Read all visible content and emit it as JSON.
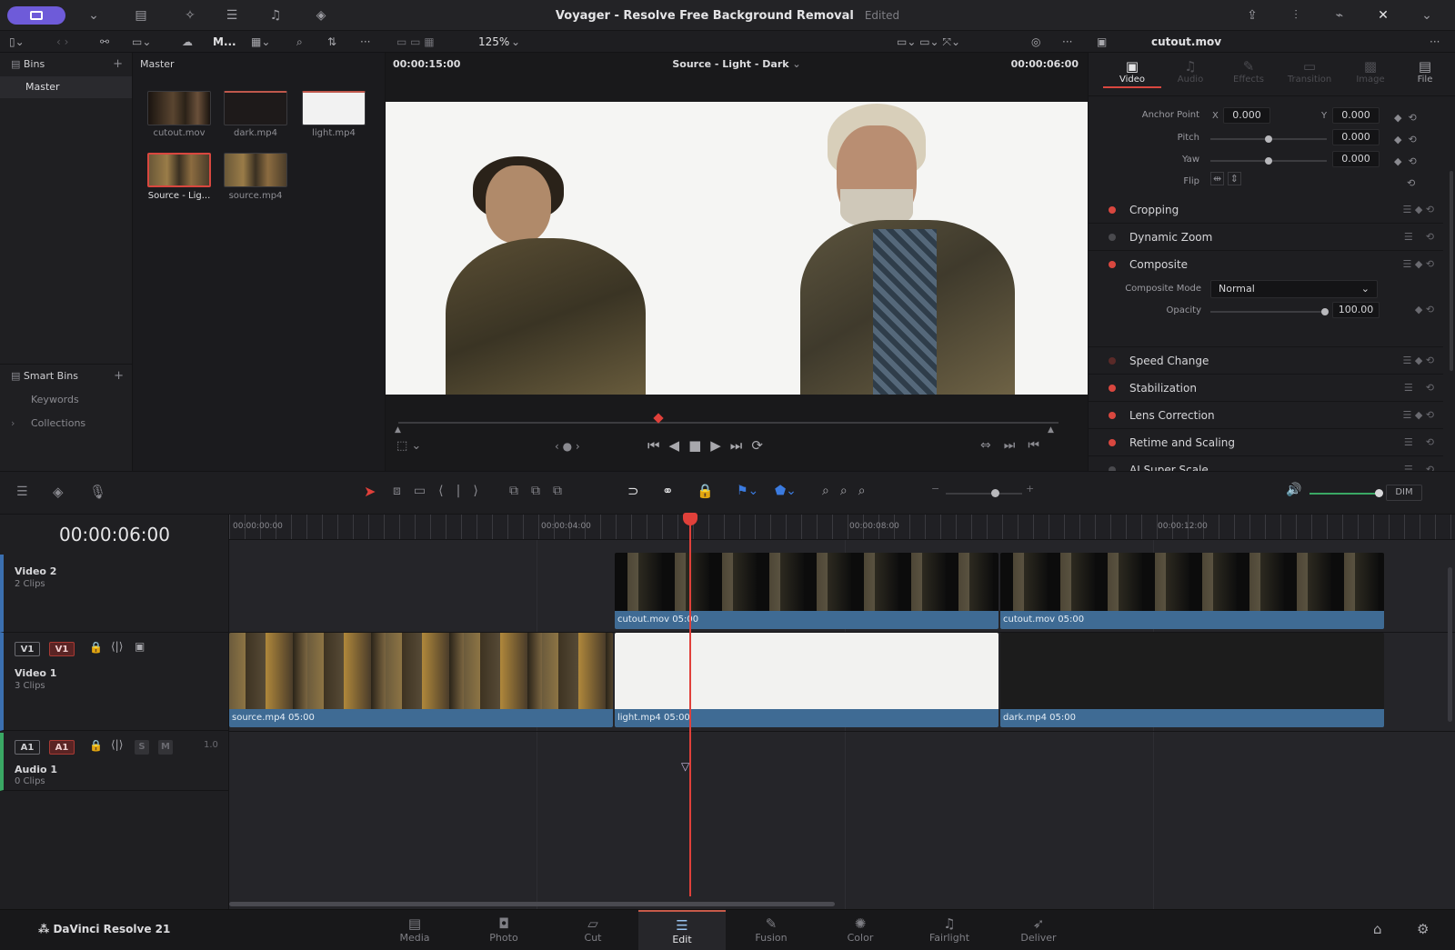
{
  "window": {
    "title": "Voyager - Resolve Free Background Removal",
    "status": "Edited"
  },
  "toolbar": {
    "media_pool_label": "M...",
    "zoom": "125%",
    "inspector_clip": "cutout.mov"
  },
  "bins": {
    "header": "Bins",
    "items": [
      "Master"
    ],
    "smart_header": "Smart Bins",
    "smart_items": [
      "Keywords",
      "Collections"
    ]
  },
  "media_pool": {
    "header": "Master",
    "clips": [
      "cutout.mov",
      "dark.mp4",
      "light.mp4",
      "Source - Lig...",
      "source.mp4"
    ]
  },
  "viewer": {
    "timecode_left": "00:00:15:00",
    "source_label": "Source - Light - Dark",
    "timecode_right": "00:00:06:00"
  },
  "inspector": {
    "tabs": [
      "Video",
      "Audio",
      "Effects",
      "Transition",
      "Image",
      "File"
    ],
    "anchor_label": "Anchor Point",
    "anchor_x_label": "X",
    "anchor_x": "0.000",
    "anchor_y_label": "Y",
    "anchor_y": "0.000",
    "pitch_label": "Pitch",
    "pitch": "0.000",
    "yaw_label": "Yaw",
    "yaw": "0.000",
    "flip_label": "Flip",
    "sections": [
      "Cropping",
      "Dynamic Zoom",
      "Composite"
    ],
    "composite_mode_label": "Composite Mode",
    "composite_mode": "Normal",
    "opacity_label": "Opacity",
    "opacity": "100.00",
    "sections2": [
      "Speed Change",
      "Stabilization",
      "Lens Correction",
      "Retime and Scaling",
      "AI Super Scale"
    ]
  },
  "timeline": {
    "timecode": "00:00:06:00",
    "ruler": [
      "00:00:00:00",
      "00:00:04:00",
      "00:00:08:00",
      "00:00:12:00"
    ],
    "volume_button": "DIM",
    "tracks": [
      {
        "name": "Video 2",
        "sub": "2 Clips"
      },
      {
        "name": "Video 1",
        "sub": "3 Clips",
        "btn_a": "V1",
        "btn_b": "V1"
      },
      {
        "name": "Audio 1",
        "sub": "0 Clips",
        "btn_a": "A1",
        "btn_b": "A1",
        "s": "S",
        "m": "M",
        "level": "1.0"
      }
    ],
    "clips": {
      "v2": [
        "cutout.mov  05:00",
        "cutout.mov  05:00"
      ],
      "v1": [
        "source.mp4  05:00",
        "light.mp4  05:00",
        "dark.mp4  05:00"
      ]
    }
  },
  "pages": {
    "app_name": "DaVinci Resolve 21",
    "items": [
      "Media",
      "Photo",
      "Cut",
      "Edit",
      "Fusion",
      "Color",
      "Fairlight",
      "Deliver"
    ],
    "active": "Edit"
  },
  "colors": {
    "accent": "#6e5bd9",
    "playhead": "#e0403a",
    "clip_label": "#3f6b94",
    "enabled_dot": "#d9473f"
  }
}
